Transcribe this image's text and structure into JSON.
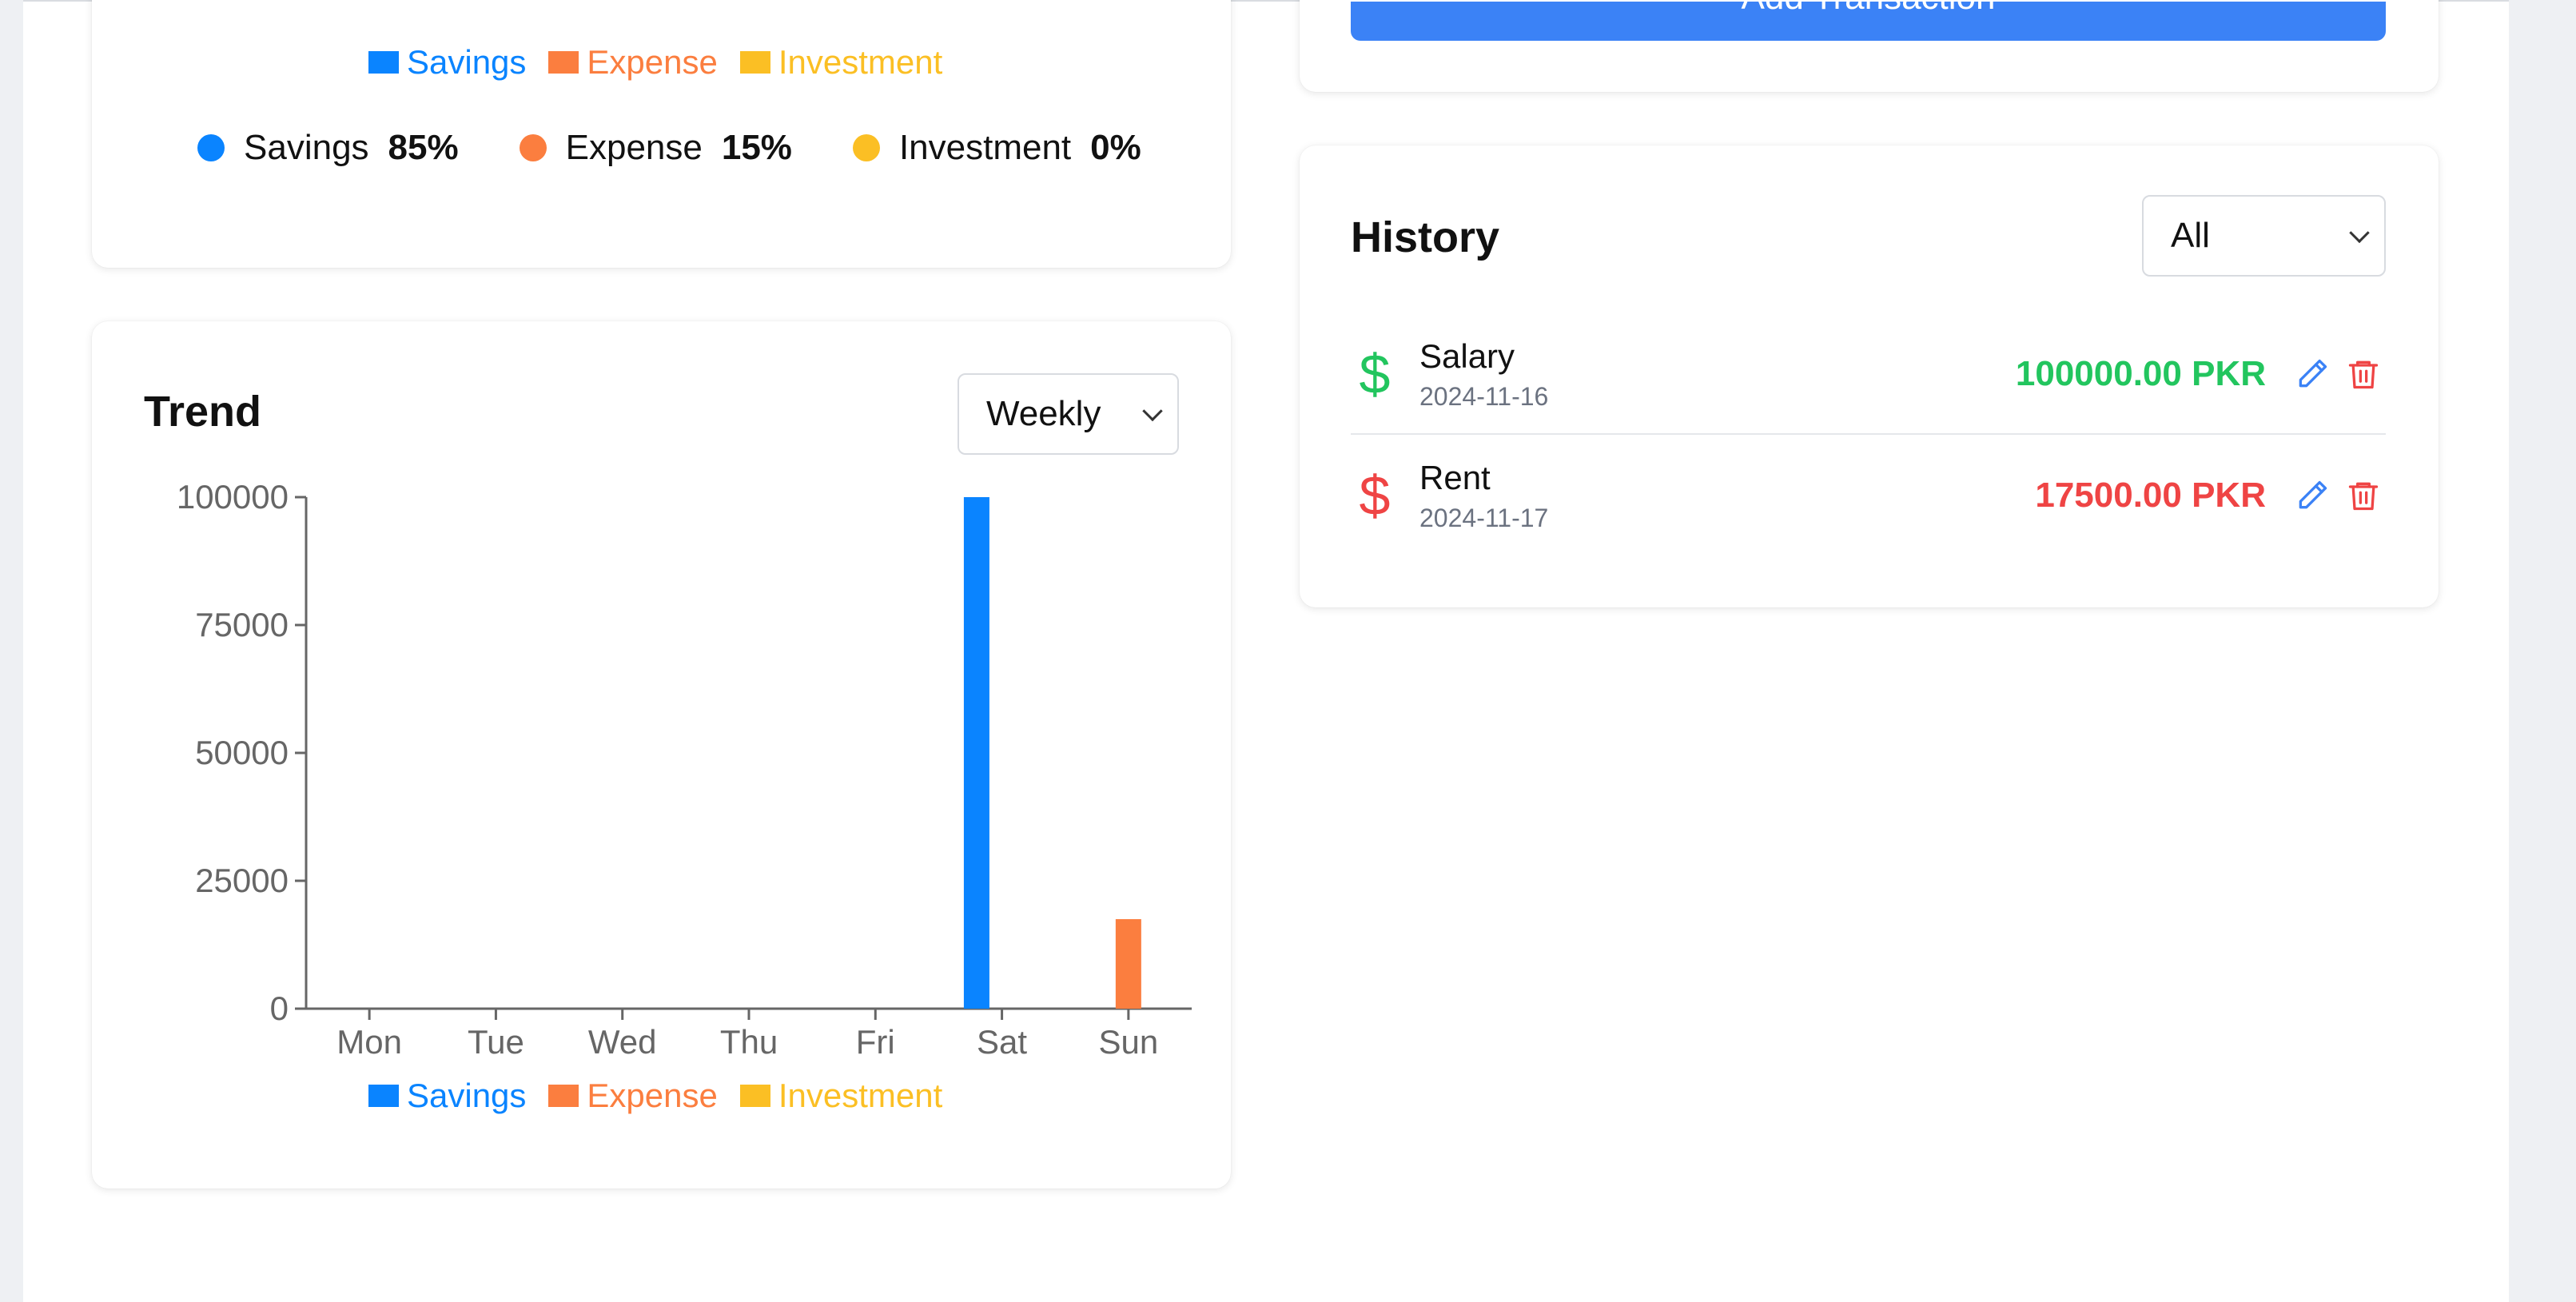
{
  "colors": {
    "savings": "#0a84ff",
    "expense": "#fb7e3f",
    "investment": "#fbbf24",
    "income_green": "#22c55e",
    "expense_red": "#ef4444",
    "edit_blue": "#3b82f6",
    "button_blue": "#3b82f6"
  },
  "distribution": {
    "legend": [
      "Savings",
      "Expense",
      "Investment"
    ],
    "percentages": [
      {
        "label": "Savings",
        "value": "85%"
      },
      {
        "label": "Expense",
        "value": "15%"
      },
      {
        "label": "Investment",
        "value": "0%"
      }
    ]
  },
  "trend": {
    "title": "Trend",
    "period_select": "Weekly",
    "legend": [
      "Savings",
      "Expense",
      "Investment"
    ]
  },
  "add_button": {
    "label": "Add Transaction"
  },
  "history": {
    "title": "History",
    "filter_select": "All",
    "transactions": [
      {
        "name": "Salary",
        "date": "2024-11-16",
        "amount": "100000.00 PKR",
        "type": "income",
        "icon": "dollar-icon"
      },
      {
        "name": "Rent",
        "date": "2024-11-17",
        "amount": "17500.00 PKR",
        "type": "expense",
        "icon": "dollar-icon"
      }
    ]
  },
  "chart_data": {
    "type": "bar",
    "categories": [
      "Mon",
      "Tue",
      "Wed",
      "Thu",
      "Fri",
      "Sat",
      "Sun"
    ],
    "series": [
      {
        "name": "Savings",
        "values": [
          0,
          0,
          0,
          0,
          0,
          100000,
          0
        ]
      },
      {
        "name": "Expense",
        "values": [
          0,
          0,
          0,
          0,
          0,
          0,
          17500
        ]
      },
      {
        "name": "Investment",
        "values": [
          0,
          0,
          0,
          0,
          0,
          0,
          0
        ]
      }
    ],
    "yticks": [
      0,
      25000,
      50000,
      75000,
      100000
    ],
    "ylim": [
      0,
      100000
    ],
    "title": "",
    "xlabel": "",
    "ylabel": "",
    "legend": "bottom",
    "grid": false
  }
}
